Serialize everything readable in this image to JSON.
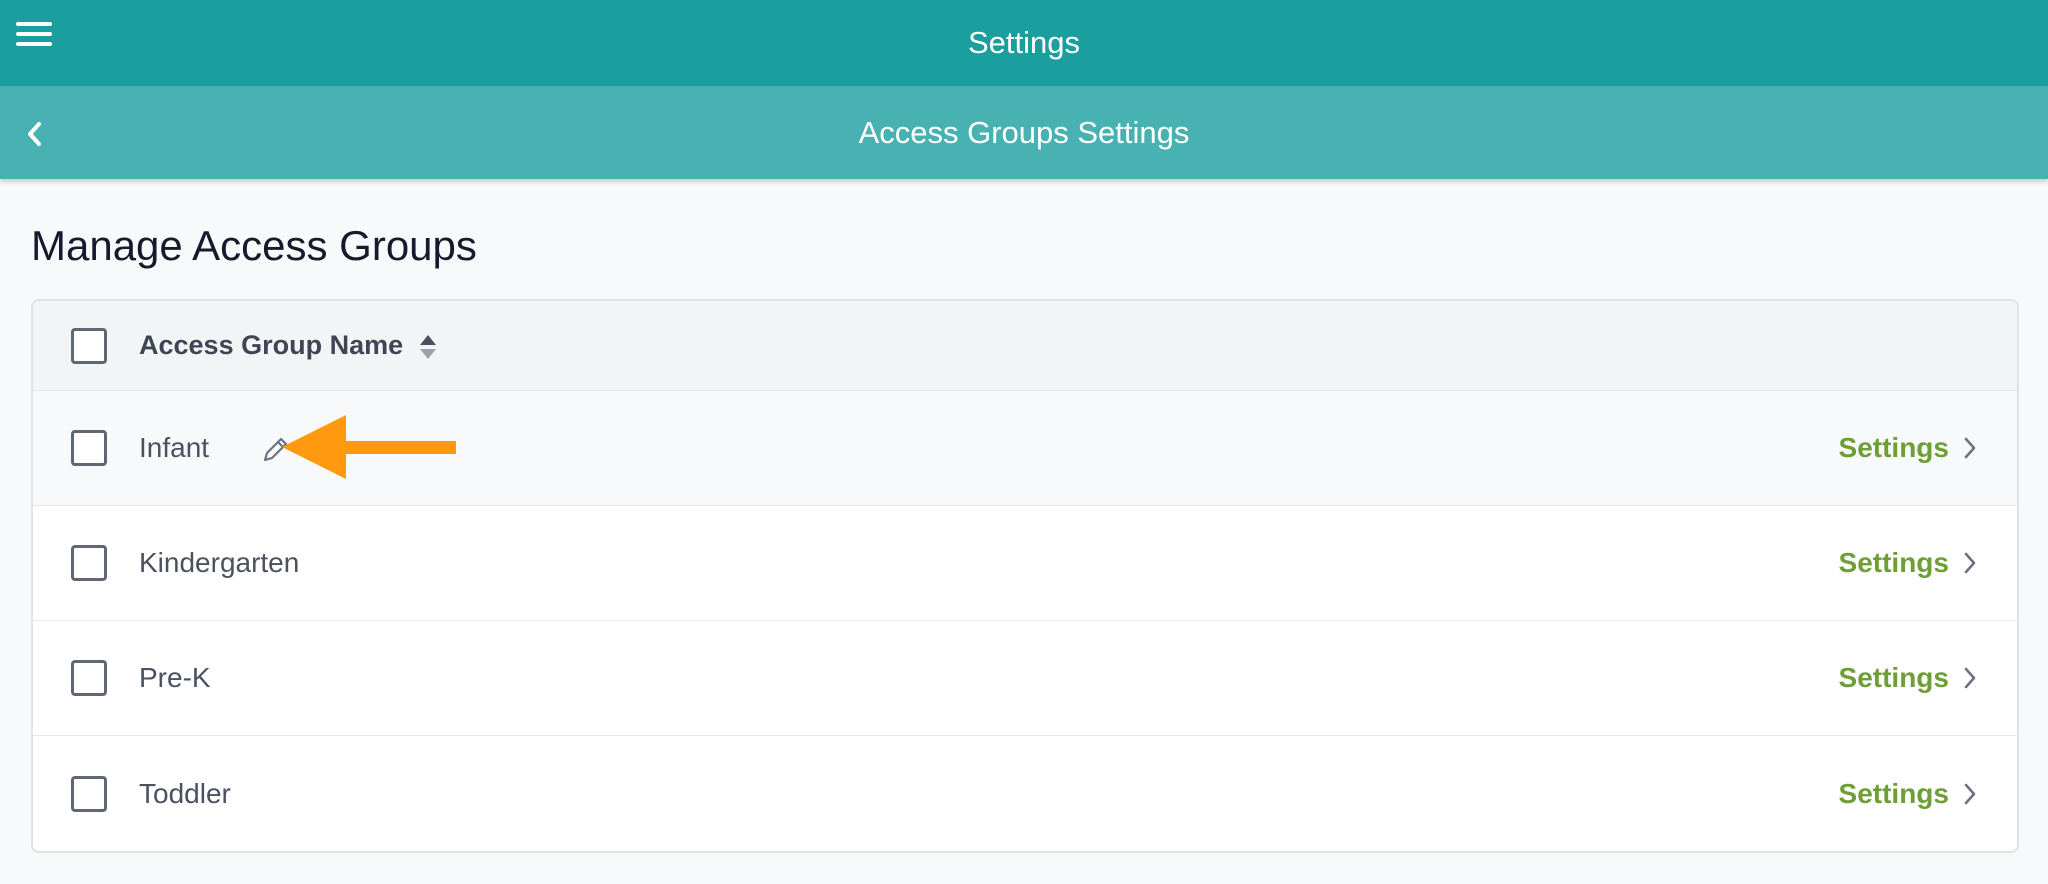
{
  "topbar": {
    "title": "Settings",
    "menu_icon": "hamburger-menu-icon"
  },
  "subbar": {
    "title": "Access Groups Settings",
    "back_icon": "chevron-left-icon"
  },
  "main": {
    "page_title": "Manage Access Groups"
  },
  "table": {
    "header": {
      "column_name": "Access Group Name",
      "sort_icon": "sort-icon"
    },
    "rows": [
      {
        "name": "Infant",
        "settings_label": "Settings",
        "editable": true
      },
      {
        "name": "Kindergarten",
        "settings_label": "Settings"
      },
      {
        "name": "Pre-K",
        "settings_label": "Settings"
      },
      {
        "name": "Toddler",
        "settings_label": "Settings"
      }
    ]
  },
  "colors": {
    "topbar": "#1a9e9e",
    "subbar": "#48b2b2",
    "link": "#6f9e36",
    "annotation_arrow": "#ff9a0e"
  }
}
